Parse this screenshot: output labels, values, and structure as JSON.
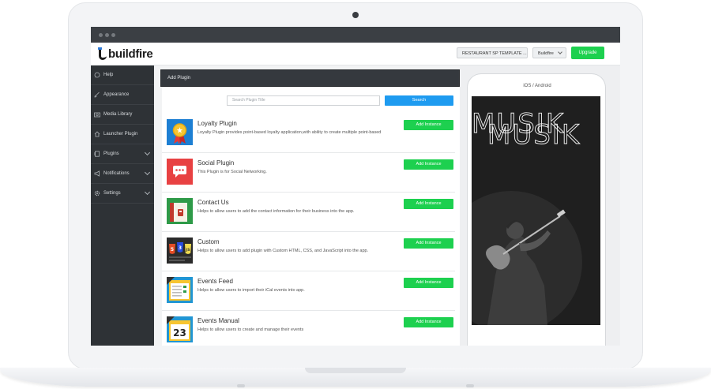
{
  "header": {
    "logo_text": "buildfire",
    "template_select": "RESTAURANT SP TEMPLATE ...",
    "account_select": "Buildfire",
    "upgrade_label": "Upgrade"
  },
  "sidebar": {
    "items": [
      {
        "label": "Help",
        "icon": "help-icon"
      },
      {
        "label": "Appearance",
        "icon": "brush-icon"
      },
      {
        "label": "Media Library",
        "icon": "camera-icon"
      },
      {
        "label": "Launcher Plugin",
        "icon": "home-icon"
      },
      {
        "label": "Plugins",
        "icon": "plugins-icon"
      },
      {
        "label": "Notifications",
        "icon": "megaphone-icon"
      },
      {
        "label": "Settings",
        "icon": "gear-icon"
      }
    ]
  },
  "panel": {
    "title": "Add Plugin",
    "search_placeholder": "Search Plugin Title",
    "search_label": "Search"
  },
  "plugins": [
    {
      "title": "Loyalty Plugin",
      "desc": "Loyalty Plugin provides point-based loyalty application,with ability to create multiple point-based",
      "button": "Add Instance"
    },
    {
      "title": "Social Plugin",
      "desc": "This Plugin is for Social Networking.",
      "button": "Add Instance"
    },
    {
      "title": "Contact Us",
      "desc": "Helps to allow users to add the contact information for their business into the app.",
      "button": "Add Instance"
    },
    {
      "title": "Custom",
      "desc": "Helps to allow users to add plugin with Custom HTML, CSS, and JavaScript into the app.",
      "button": "Add Instance"
    },
    {
      "title": "Events Feed",
      "desc": "Helps to allow users to import their iCal events into app.",
      "button": "Add Instance"
    },
    {
      "title": "Events Manual",
      "desc": "Helps to allow users to create and manage their events",
      "button": "Add Instance"
    }
  ],
  "icons": {
    "loyalty_badge": "★",
    "calendar_day": "23",
    "html_badge": "5",
    "css_badge": "3",
    "js_badge": "JS"
  },
  "preview": {
    "platform_label": "iOS / Android",
    "hero_text": "MUSIK"
  },
  "colors": {
    "accent_green": "#1dd04f",
    "accent_blue": "#1e9bf0",
    "sidebar_bg": "#2e3236"
  }
}
